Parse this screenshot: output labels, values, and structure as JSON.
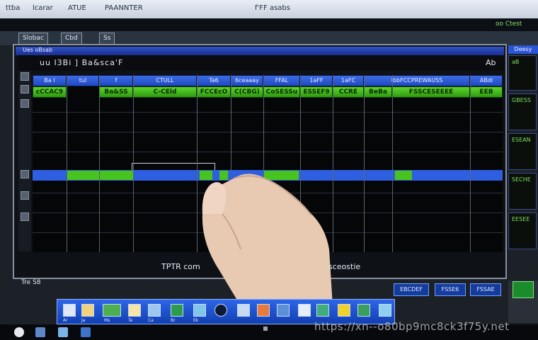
{
  "top_menu": {
    "items": [
      "ttba",
      "lcarar",
      "ATUE",
      "PAANNTER"
    ],
    "title": "f'FF asabs"
  },
  "second_bar": {
    "indicator": "oo Ctest"
  },
  "toolbar": {
    "buttons": [
      "Slobac",
      "Cbd",
      "Ss"
    ]
  },
  "window": {
    "title": "Ues oBsab",
    "header_title": "uu I3Bi ] Ba&sca'F",
    "header_right": "Ab"
  },
  "grid": {
    "column_headers": [
      "Ba l",
      "tul",
      "f",
      "CTULL",
      "Ta6",
      "6ceaaay",
      "FFAL",
      "1aFF",
      "1aFC",
      "lbbFCCPREWAUSS",
      "ABdl"
    ],
    "green_labels": [
      "cCCAC9",
      "Ba&SS",
      "C-CEld",
      "FCCEcO",
      "C(CBG)",
      "CoSESSu",
      "ESSEF9",
      "CCRE",
      "BeBa",
      "FSSCESEEEE",
      "EEB"
    ],
    "band_green_cells": 5
  },
  "bottom": {
    "left_label": "TPTR com",
    "right_label": "sceostie",
    "corner_label": "Tre S8",
    "action_buttons": [
      "EBCDEF",
      "FSSE6",
      "FSSAE"
    ]
  },
  "right_panels": {
    "header": "Deesy",
    "values": [
      "aB",
      "GBESS",
      "ESEAN",
      "SECHE",
      "EESEE"
    ]
  },
  "dock": {
    "items": [
      "Ar",
      "Ja",
      "Ms",
      "Te",
      "Ca",
      "Br",
      "Ek",
      "",
      "",
      "",
      "",
      "",
      "",
      "",
      "",
      "",
      ""
    ]
  },
  "watermark": "https://xn--o80bp9mc8ck3f75y.net",
  "colors": {
    "header_blue": "#2e5fe0",
    "signal_green": "#47c51e",
    "grid_bg": "#050608"
  }
}
